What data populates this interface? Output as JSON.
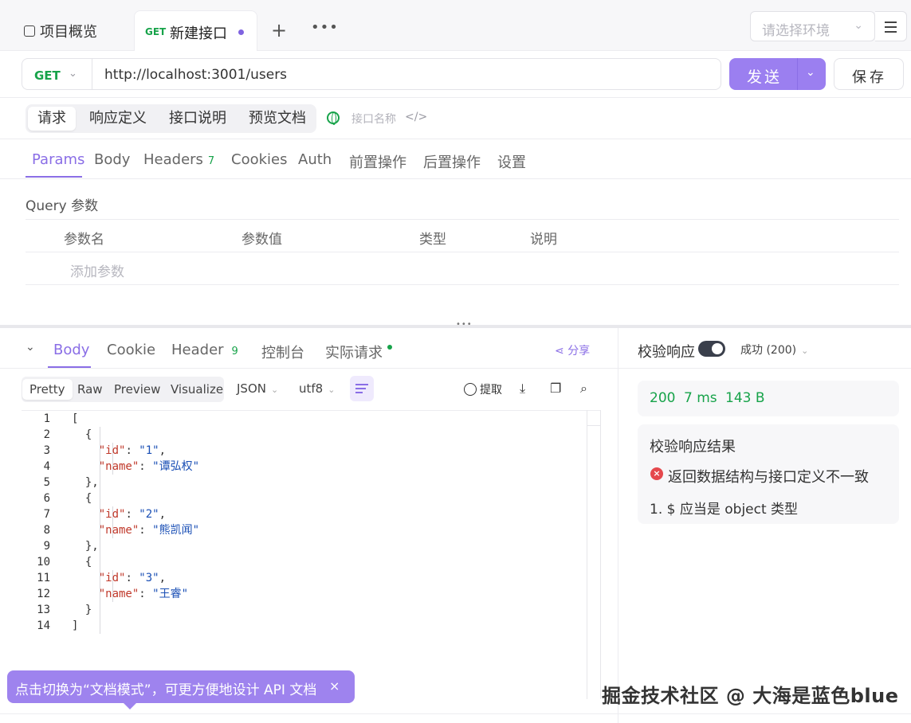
{
  "top_tabs": {
    "overview": "项目概览",
    "active_method": "GET",
    "active_title": "新建接口",
    "env_placeholder": "请选择环境"
  },
  "request": {
    "method": "GET",
    "url": "http://localhost:3001/users",
    "send_label": "发送",
    "save_label": "保存"
  },
  "sub_tabs": [
    "请求",
    "响应定义",
    "接口说明",
    "预览文档"
  ],
  "name_placeholder": "接口名称",
  "param_tabs": {
    "items": [
      "Params",
      "Body",
      "Headers",
      "Cookies",
      "Auth",
      "前置操作",
      "后置操作",
      "设置"
    ],
    "headers_count": "7"
  },
  "query": {
    "title": "Query 参数",
    "columns": [
      "参数名",
      "参数值",
      "类型",
      "说明"
    ],
    "add_placeholder": "添加参数"
  },
  "response": {
    "tabs": [
      "Body",
      "Cookie",
      "Header",
      "控制台",
      "实际请求"
    ],
    "header_count": "9",
    "share": "分享",
    "formats": [
      "Pretty",
      "Raw",
      "Preview",
      "Visualize"
    ],
    "lang": "JSON",
    "encoding": "utf8",
    "extract": "提取",
    "code_lines": [
      {
        "n": "1"
      },
      {
        "n": "2"
      },
      {
        "n": "3"
      },
      {
        "n": "4"
      },
      {
        "n": "5"
      },
      {
        "n": "6"
      },
      {
        "n": "7"
      },
      {
        "n": "8"
      },
      {
        "n": "9"
      },
      {
        "n": "10"
      },
      {
        "n": "11"
      },
      {
        "n": "12"
      },
      {
        "n": "13"
      },
      {
        "n": "14"
      }
    ],
    "records": [
      {
        "id": "1",
        "name": "谭弘权"
      },
      {
        "id": "2",
        "name": "熊凯闻"
      },
      {
        "id": "3",
        "name": "王睿"
      }
    ]
  },
  "tooltip": {
    "text": "点击切换为“文档模式”，可更方便地设计 API 文档",
    "close": "×"
  },
  "validation": {
    "label": "校验响应",
    "status": "成功 (200)",
    "code": "200",
    "time": "7 ms",
    "size": "143 B",
    "result_title": "校验响应结果",
    "error": "返回数据结构与接口定义不一致",
    "detail": "1. $ 应当是 object 类型"
  },
  "watermark": "掘金技术社区 @ 大海是蓝色blue",
  "colors": {
    "accent": "#8a6ee6",
    "get": "#17a34a",
    "error": "#e5484d"
  }
}
